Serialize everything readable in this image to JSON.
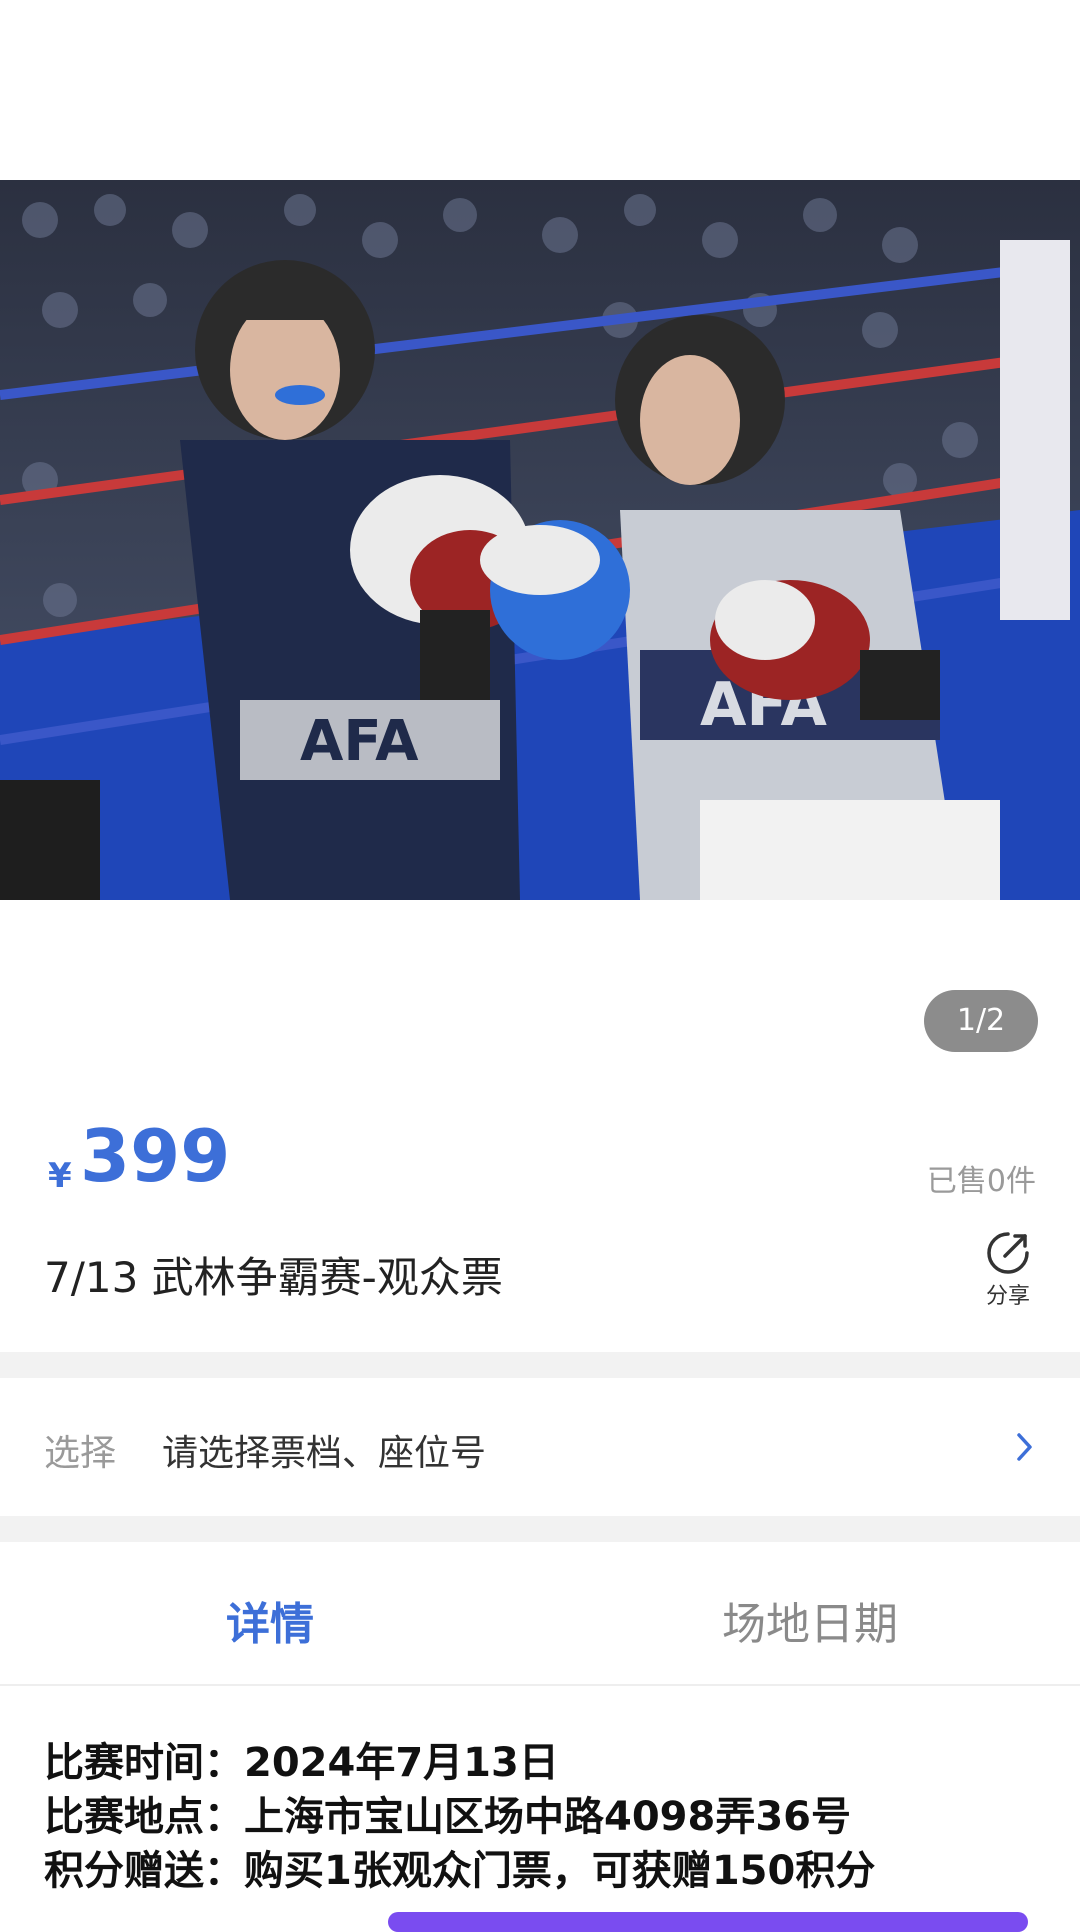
{
  "gallery": {
    "image_alt": "",
    "indicator": "1/2"
  },
  "product": {
    "currency": "¥",
    "price": "399",
    "sold": "已售0件",
    "title": "7/13 武林争霸赛-观众票",
    "share_label": "分享",
    "share_icon": "share-icon"
  },
  "selector": {
    "label": "选择",
    "value": "请选择票档、座位号",
    "chevron_icon": "chevron-right-icon"
  },
  "tabs": [
    {
      "label": "详情",
      "active": true
    },
    {
      "label": "场地日期",
      "active": false
    }
  ],
  "details": {
    "lines": [
      "比赛时间：2024年7月13日",
      "比赛地点：上海市宝山区场中路4098弄36号",
      "积分赠送：购买1张观众门票，可获赠150积分"
    ]
  },
  "colors": {
    "accent": "#3d6fd8",
    "indicator_bg": "#8c8c8c",
    "divider": "#f2f2f2",
    "bottom_bar": "#7a4cf0"
  }
}
